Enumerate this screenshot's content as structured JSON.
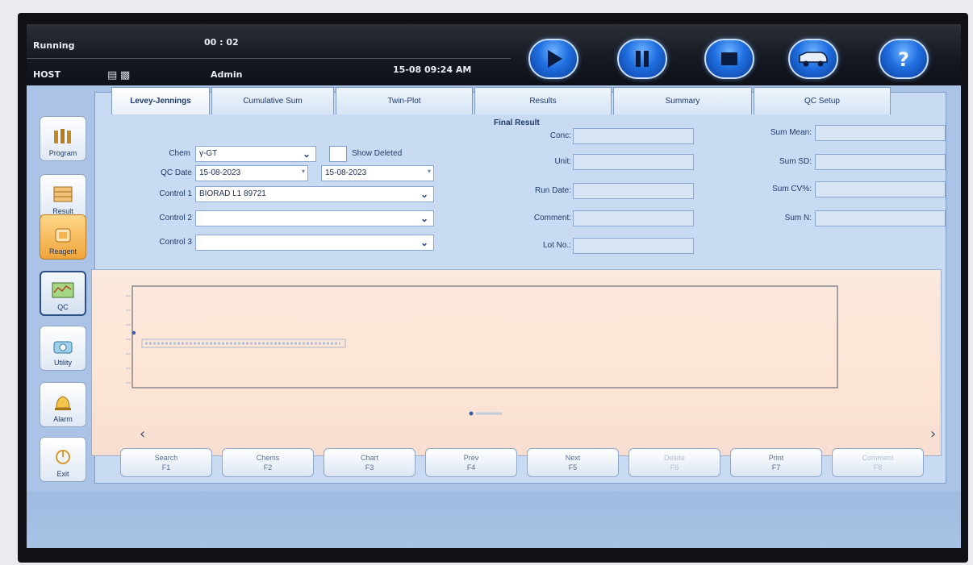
{
  "status": {
    "state": "Running",
    "timer": "00 : 02",
    "host": "HOST",
    "user": "Admin",
    "datetime": "15-08 09:24 AM"
  },
  "controls": [
    {
      "name": "play",
      "icon": "play-icon"
    },
    {
      "name": "pause",
      "icon": "pause-icon"
    },
    {
      "name": "stop",
      "icon": "stop-icon"
    },
    {
      "name": "ambulance",
      "icon": "ambulance-icon"
    },
    {
      "name": "help",
      "icon": "help-icon"
    }
  ],
  "sidebar": {
    "items": [
      {
        "label": "Program",
        "icon": "program-icon"
      },
      {
        "label": "Result",
        "icon": "result-icon"
      },
      {
        "label": "Reagent",
        "icon": "reagent-icon"
      },
      {
        "label": "QC",
        "icon": "qc-icon"
      },
      {
        "label": "Utility",
        "icon": "utility-icon"
      },
      {
        "label": "Alarm",
        "icon": "alarm-icon"
      },
      {
        "label": "Exit",
        "icon": "exit-icon"
      }
    ]
  },
  "tabs": [
    "Levey-Jennings",
    "Cumulative Sum",
    "Twin-Plot",
    "Results",
    "Summary",
    "QC Setup"
  ],
  "form": {
    "chem_label": "Chem",
    "chem_value": "γ-GT",
    "show_deleted_label": "Show Deleted",
    "qc_date_label": "QC Date",
    "qc_date_from": "15-08-2023",
    "qc_date_to": "15-08-2023",
    "control1_label": "Control 1",
    "control1_value": "BIORAD L1 89721",
    "control2_label": "Control 2",
    "control2_value": "",
    "control3_label": "Control 3",
    "control3_value": ""
  },
  "final_result": {
    "title": "Final Result",
    "conc_label": "Conc:",
    "unit_label": "Unit:",
    "run_date_label": "Run Date:",
    "comment_label": "Comment:",
    "lot_no_label": "Lot No.:"
  },
  "summary": {
    "mean_label": "Sum Mean:",
    "sd_label": "Sum SD:",
    "cv_label": "Sum CV%:",
    "n_label": "Sum N:"
  },
  "function_keys": [
    {
      "label": "Search",
      "key": "F1",
      "enabled": true
    },
    {
      "label": "Chems",
      "key": "F2",
      "enabled": true
    },
    {
      "label": "Chart",
      "key": "F3",
      "enabled": true
    },
    {
      "label": "Prev",
      "key": "F4",
      "enabled": true
    },
    {
      "label": "Next",
      "key": "F5",
      "enabled": true
    },
    {
      "label": "Delete",
      "key": "F6",
      "enabled": false
    },
    {
      "label": "Print",
      "key": "F7",
      "enabled": true
    },
    {
      "label": "Comment",
      "key": "F8",
      "enabled": false
    }
  ],
  "colors": {
    "accent": "#1f6fe0",
    "chart_bg": "#fbe9dd",
    "reagent_active": "#f0a53a"
  }
}
